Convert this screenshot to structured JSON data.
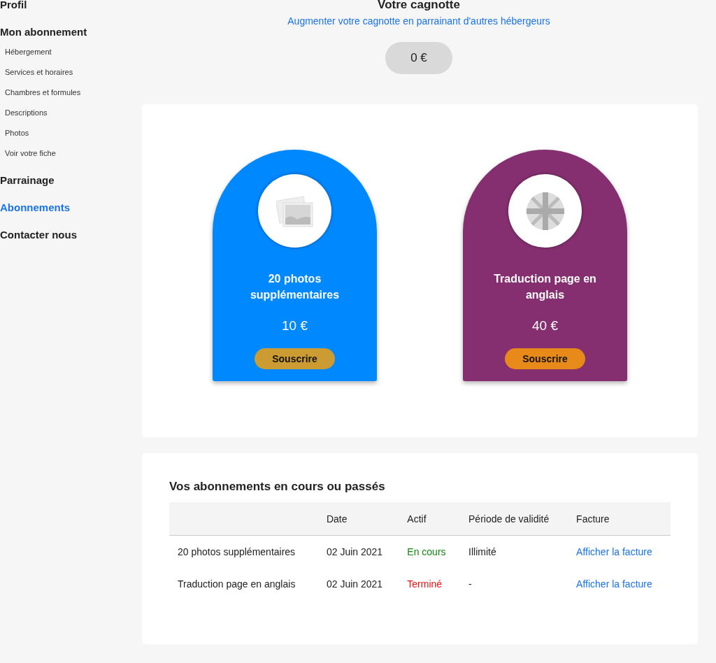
{
  "sidebar": {
    "items": [
      {
        "label": "Profil",
        "selected": false
      },
      {
        "label": "Mon abonnement",
        "selected": false,
        "children": [
          {
            "label": "Hébergement"
          },
          {
            "label": "Services et horaires"
          },
          {
            "label": "Chambres et formules"
          },
          {
            "label": "Descriptions"
          },
          {
            "label": "Photos"
          },
          {
            "label": "Voir votre fiche"
          }
        ]
      },
      {
        "label": "Parrainage",
        "selected": false
      },
      {
        "label": "Abonnements",
        "selected": true
      },
      {
        "label": "Contacter nous",
        "selected": false
      }
    ]
  },
  "header": {
    "title": "Votre cagnotte",
    "link": "Augmenter votre cagnotte en parrainant d'autres hébergeurs",
    "balance": "0 €"
  },
  "offers": [
    {
      "kind": "photos",
      "title": "20 photos supplémentaires",
      "price": "10 €",
      "button": {
        "label": "Souscrire",
        "color": "#cc9c33"
      },
      "color": "#0088ff"
    },
    {
      "kind": "flag",
      "title": "Traduction page en anglais",
      "price": "40 €",
      "button": {
        "label": "Souscrire",
        "color": "#e88a1a"
      },
      "color": "#852f70"
    }
  ],
  "subscriptions": {
    "title": "Vos abonnements en cours ou passés",
    "columns": [
      "Date",
      "Actif",
      "Période de validité",
      "Facture"
    ],
    "rows": [
      {
        "name": "20 photos supplémentaires",
        "date": "02 Juin 2021",
        "status": {
          "label": "En cours",
          "color": "#118811"
        },
        "validity": "Illimité",
        "invoice": "Afficher la facture"
      },
      {
        "name": "Traduction page en anglais",
        "date": "02 Juin 2021",
        "status": {
          "label": "Terminé",
          "color": "#ee1111"
        },
        "validity": "-",
        "invoice": "Afficher la facture"
      }
    ]
  }
}
